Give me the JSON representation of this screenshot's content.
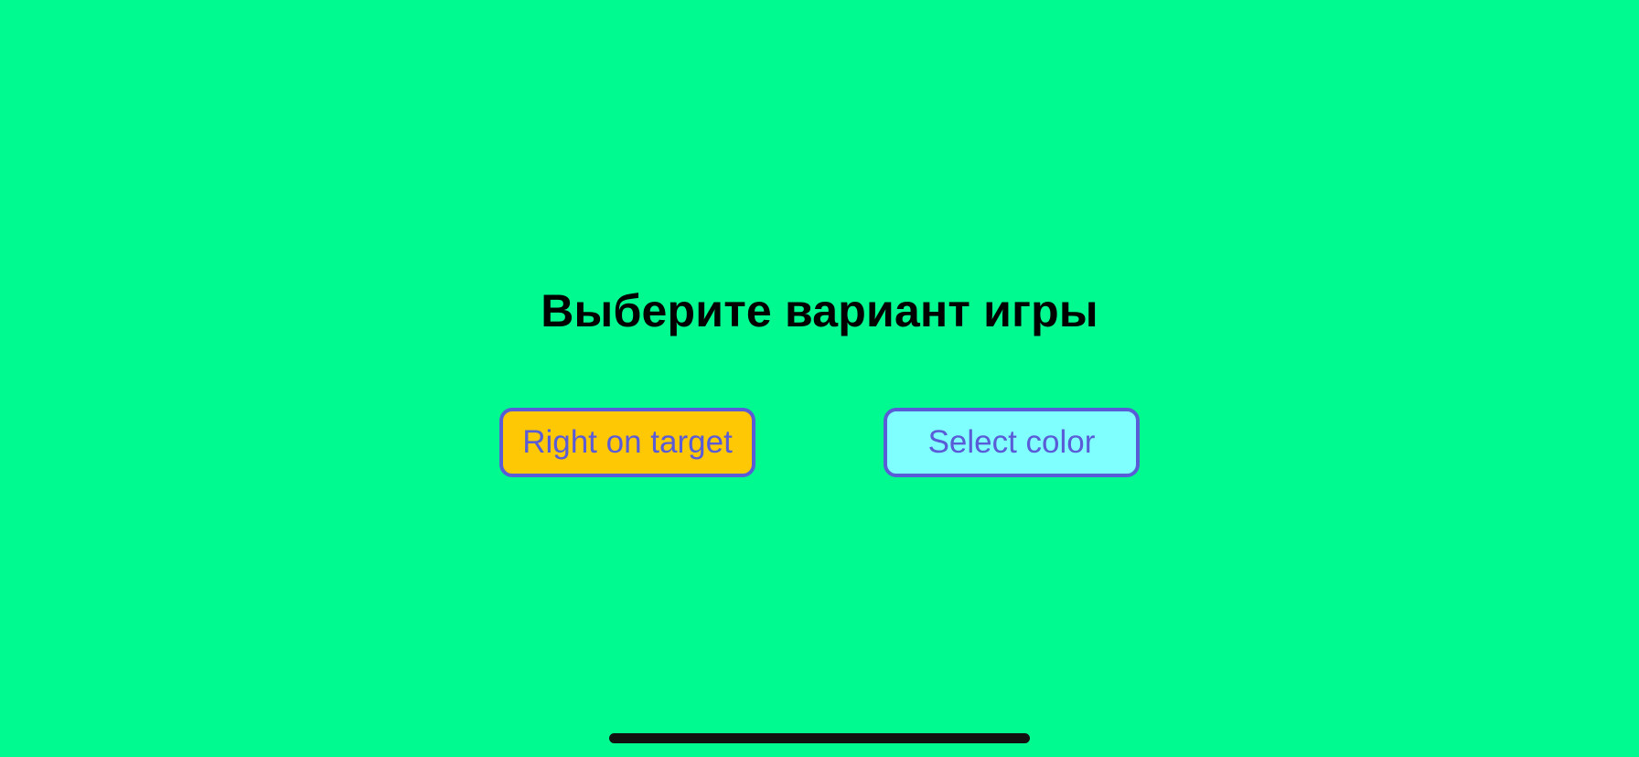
{
  "screen": {
    "title": "Выберите вариант игры",
    "background_color": "#00FA90"
  },
  "buttons": {
    "right_on_target": {
      "label": "Right on target",
      "background_color": "#FFC804"
    },
    "select_color": {
      "label": "Select color",
      "background_color": "#80FFFF"
    },
    "border_color": "#5A5BD6",
    "text_color": "#5A5BD6"
  },
  "system": {
    "home_indicator_icon": "home-indicator"
  }
}
